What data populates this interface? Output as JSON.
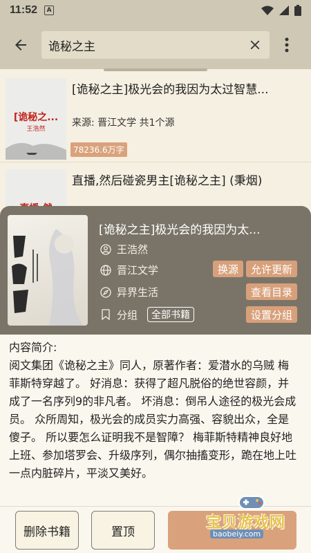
{
  "status_bar": {
    "time": "11:52",
    "badge": "A"
  },
  "toolbar": {
    "search_value": "诡秘之主",
    "icons": [
      "back-arrow-icon",
      "clear-icon",
      "more-vert-icon"
    ]
  },
  "results": [
    {
      "title": "[诡秘之主]极光会的我因为太过智慧...",
      "source": "来源: 晋江文学  共1个源",
      "words": "78236.6万字",
      "cover_title": "[诡秘之...",
      "cover_author": "王浩然"
    },
    {
      "title": "直播,然后碰瓷男主[诡秘之主] (秉烟)",
      "cover_title": "直播,然"
    }
  ],
  "detail": {
    "title": "[诡秘之主]极光会的我因为太...",
    "author": "王浩然",
    "source": "晋江文学",
    "category": "异界生活",
    "group_label": "分组",
    "group_value": "全部书籍",
    "buttons": {
      "change_source": "换源",
      "allow_update": "允许更新",
      "view_toc": "查看目录",
      "set_group": "设置分组"
    },
    "intro_label": "内容简介:",
    "intro_text": "阅文集团《诡秘之主》同人，原著作者：爱潜水的乌贼 梅菲斯特穿越了。 好消息：获得了超凡脱俗的绝世容颜，并成了一名序列9的非凡者。 坏消息：倒吊人途径的极光会成员。 众所周知，极光会的成员实力高强、容貌出众，全是傻子。 所以要怎么证明我不是智障？ 梅菲斯特精神良好地上班、参加塔罗会、升级序列，偶尔抽搐变形，跪在地上吐一点内脏碎片，平淡又美好。"
  },
  "bottom_bar": {
    "delete": "删除书籍",
    "pin": "置顶"
  },
  "watermark": {
    "text": "宝贝游戏网",
    "url": "baobeiy.com"
  },
  "colors": {
    "accent": "#d9a27c",
    "sheet_header": "#7a7468",
    "toolbar": "#cfc8b4"
  }
}
